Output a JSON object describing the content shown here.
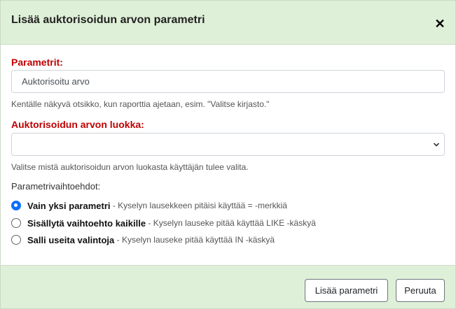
{
  "modal": {
    "title": "Lisää auktorisoidun arvon parametri",
    "close_glyph": "✕",
    "close_icon": "close-icon"
  },
  "parameter": {
    "label": "Parametrit:",
    "input_value": "Auktorisoitu arvo",
    "help": "Kentälle näkyvä otsikko, kun raporttia ajetaan, esim. \"Valitse kirjasto.\""
  },
  "class_field": {
    "label": "Auktorisoidun arvon luokka:",
    "selected_value": "",
    "chevron_icon": "chevron-down-icon",
    "help": "Valitse mistä auktorisoidun arvon luokasta käyttäjän tulee valita."
  },
  "options": {
    "label": "Parametrivaihtoehdot:",
    "items": [
      {
        "label": "Vain yksi parametri",
        "description": " - Kyselyn lausekkeen pitäisi käyttää = -merkkiä",
        "checked": true
      },
      {
        "label": "Sisällytä vaihtoehto kaikille",
        "description": " - Kyselyn lauseke pitää käyttää LIKE -käskyä",
        "checked": false
      },
      {
        "label": "Salli useita valintoja",
        "description": " - Kyselyn lauseke pitää käyttää IN -käskyä",
        "checked": false
      }
    ]
  },
  "footer": {
    "add_label": "Lisää parametri",
    "cancel_label": "Peruuta"
  },
  "colors": {
    "header_bg": "#dff0d8",
    "required_label": "#c00000",
    "radio_checked": "#0d6efd"
  }
}
